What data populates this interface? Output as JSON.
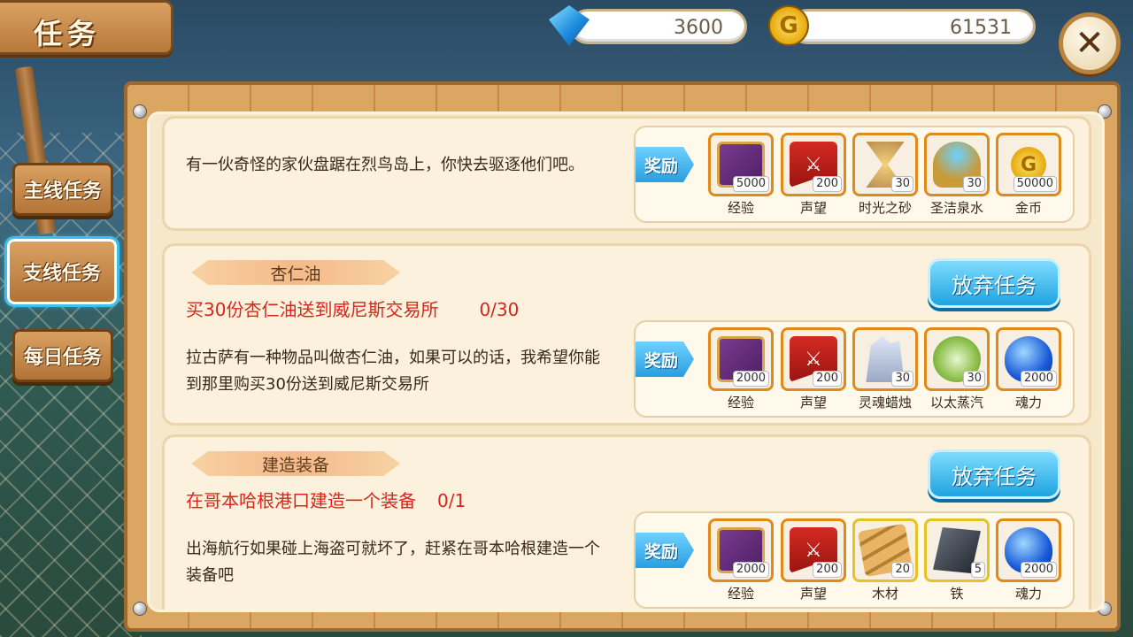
{
  "header": {
    "title": "任务"
  },
  "resources": {
    "gems": "3600",
    "gold": "61531",
    "gold_symbol": "G"
  },
  "close_symbol": "✕",
  "tabs": [
    {
      "label": "主线任务"
    },
    {
      "label": "支线任务"
    },
    {
      "label": "每日任务"
    }
  ],
  "reward_label": "奖励",
  "quests": [
    {
      "description": "有一伙奇怪的家伙盘踞在烈鸟岛上，你快去驱逐他们吧。",
      "rewards": [
        {
          "name": "经验",
          "qty": "5000",
          "icon": "book-icon"
        },
        {
          "name": "声望",
          "qty": "200",
          "icon": "banner-icon"
        },
        {
          "name": "时光之砂",
          "qty": "30",
          "icon": "hourglass-icon"
        },
        {
          "name": "圣洁泉水",
          "qty": "30",
          "icon": "chalice-icon"
        },
        {
          "name": "金币",
          "qty": "50000",
          "icon": "coin-icon"
        }
      ]
    },
    {
      "name": "杏仁油",
      "objective": "买30份杏仁油送到威尼斯交易所",
      "progress": "0/30",
      "description": "拉古萨有一种物品叫做杏仁油，如果可以的话，我希望你能到那里购买30份送到威尼斯交易所",
      "abandon_label": "放弃任务",
      "rewards": [
        {
          "name": "经验",
          "qty": "2000",
          "icon": "book-icon"
        },
        {
          "name": "声望",
          "qty": "200",
          "icon": "banner-icon"
        },
        {
          "name": "灵魂蜡烛",
          "qty": "30",
          "icon": "candle-icon"
        },
        {
          "name": "以太蒸汽",
          "qty": "30",
          "icon": "steam-icon"
        },
        {
          "name": "魂力",
          "qty": "2000",
          "icon": "soul-icon"
        }
      ]
    },
    {
      "name": "建造装备",
      "objective": "在哥本哈根港口建造一个装备",
      "progress": "0/1",
      "description": "出海航行如果碰上海盗可就坏了，赶紧在哥本哈根建造一个装备吧",
      "abandon_label": "放弃任务",
      "rewards": [
        {
          "name": "经验",
          "qty": "2000",
          "icon": "book-icon"
        },
        {
          "name": "声望",
          "qty": "200",
          "icon": "banner-icon"
        },
        {
          "name": "木材",
          "qty": "20",
          "icon": "wood-icon"
        },
        {
          "name": "铁",
          "qty": "5",
          "icon": "iron-icon"
        },
        {
          "name": "魂力",
          "qty": "2000",
          "icon": "soul-icon"
        }
      ]
    }
  ]
}
